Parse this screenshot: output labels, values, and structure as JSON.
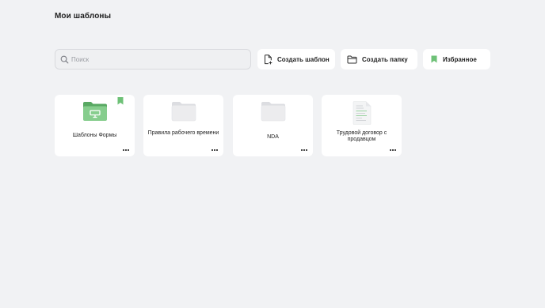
{
  "page": {
    "title": "Мои шаблоны"
  },
  "toolbar": {
    "search_placeholder": "Поиск",
    "create_template_label": "Создать шаблон",
    "create_folder_label": "Создать папку",
    "favorites_label": "Избранное"
  },
  "colors": {
    "accent_green": "#6ec177",
    "background": "#f1f2f4",
    "card": "#ffffff"
  },
  "items": [
    {
      "name": "Шаблоны Формы",
      "type": "folder",
      "icon": "green-folder-icon",
      "favorite": true
    },
    {
      "name": "Правила рабочего времени",
      "type": "folder",
      "icon": "folder-icon",
      "favorite": false
    },
    {
      "name": "NDA",
      "type": "folder",
      "icon": "folder-icon",
      "favorite": false
    },
    {
      "name": "Трудовой договор с продавцом",
      "type": "document",
      "icon": "document-icon",
      "favorite": false
    }
  ]
}
